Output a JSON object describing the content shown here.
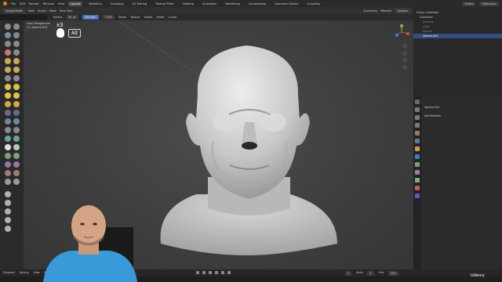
{
  "menubar": {
    "menus": [
      "File",
      "Edit",
      "Render",
      "Window",
      "Help"
    ],
    "workspaces": [
      "Layout",
      "Modeling",
      "Sculpting",
      "UV Editing",
      "Texture Paint",
      "Shading",
      "Animation",
      "Rendering",
      "Compositing",
      "Geometry Nodes",
      "Scripting"
    ],
    "active_workspace": "Layout",
    "scene": "Scene",
    "view_layer": "ViewLayer"
  },
  "header": {
    "mode": "Sculpt Mode",
    "menus": [
      "View",
      "Sculpt",
      "Mask",
      "Face Sets"
    ],
    "radius_label": "Radius",
    "radius": "61 px",
    "strength_label": "Strength",
    "strength": "0.400",
    "options": [
      "Brush",
      "Texture",
      "Stroke",
      "Falloff",
      "Cursor"
    ],
    "right": [
      "Symmetry",
      "Remesh",
      "Options"
    ]
  },
  "viewport": {
    "view_name": "User Perspective",
    "object_name": "(1) Sphere.001",
    "key_count": "x3",
    "key_label": "Alt"
  },
  "outliner": {
    "title": "Scene Collection",
    "rows": [
      "Collection",
      "Camera",
      "Light",
      "Sphere",
      "Sphere.001"
    ]
  },
  "properties": {
    "object": "Sphere.001",
    "add_modifier": "Add Modifier"
  },
  "timeline": {
    "menus": [
      "Playback",
      "Keying",
      "View",
      "Marker"
    ],
    "current_frame": "1",
    "start_label": "Start",
    "start": "1",
    "end_label": "End",
    "end": "250"
  },
  "watermark": "Udemy",
  "colors": {
    "accent": "#4772b3",
    "selected": "#334d80",
    "brand": "#e87d0d"
  }
}
